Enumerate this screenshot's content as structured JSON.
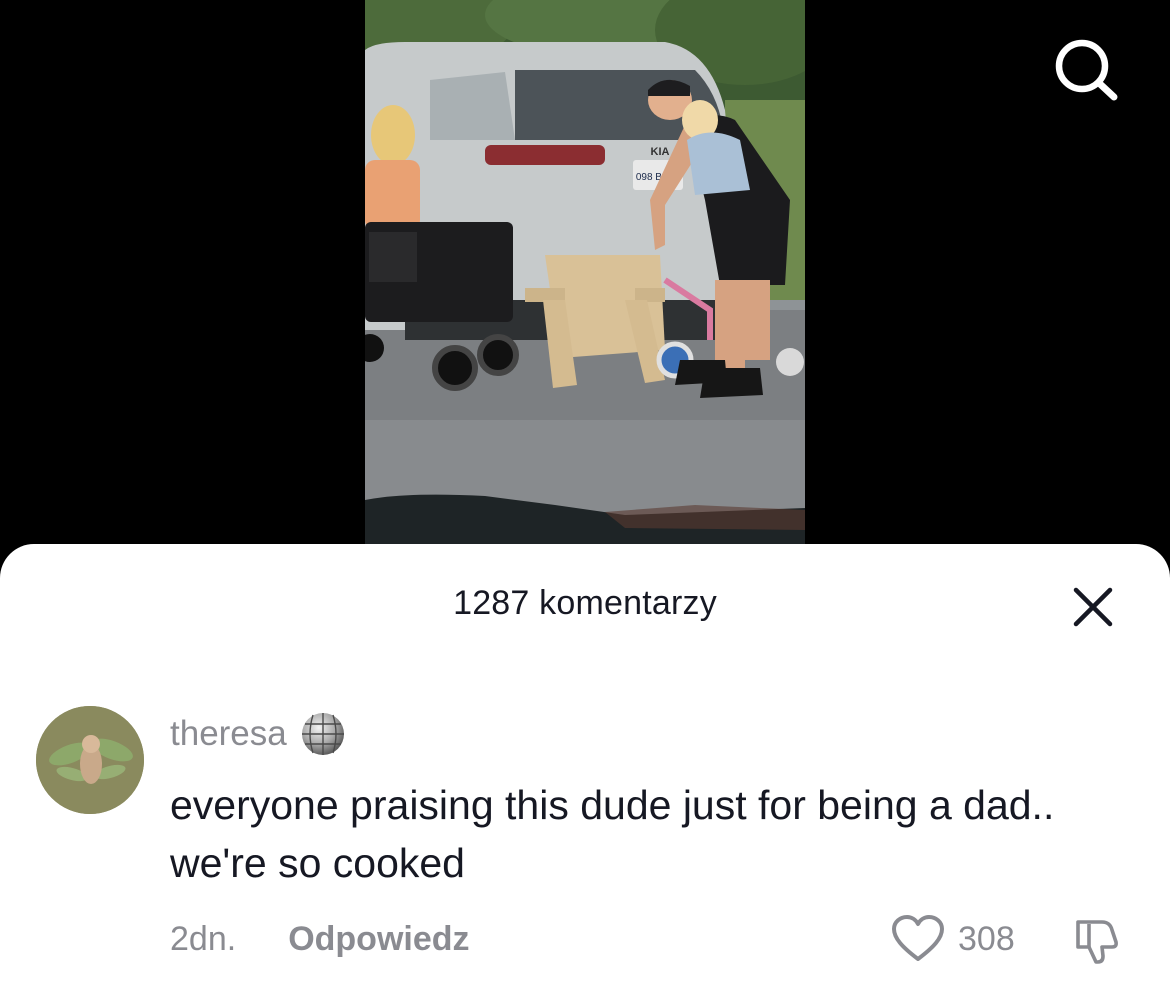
{
  "video": {
    "plate_text": "098 BLYV",
    "brand_text": "KIA"
  },
  "icons": {
    "search": "search-icon",
    "close": "close-icon",
    "heart": "heart-icon",
    "dislike": "thumbs-down-icon",
    "badge": "disco-ball-icon"
  },
  "comments_sheet": {
    "title": "1287 komentarzy"
  },
  "comment": {
    "username": "theresa",
    "text": "everyone praising this dude just for being a dad.. we're so cooked",
    "time": "2dn.",
    "reply_label": "Odpowiedz",
    "like_count": "308"
  },
  "colors": {
    "sheet_bg": "#ffffff",
    "primary_text": "#161823",
    "secondary_text": "#8a8b91"
  }
}
